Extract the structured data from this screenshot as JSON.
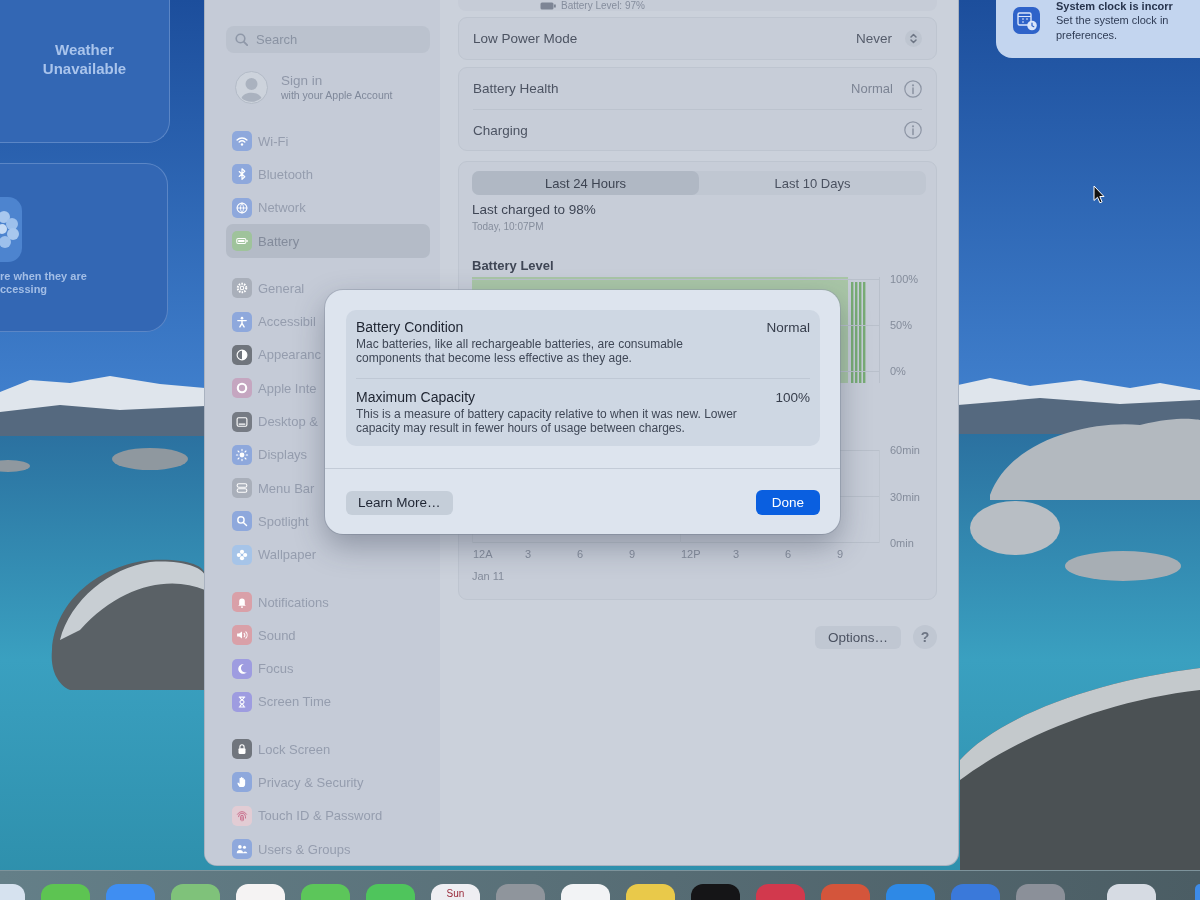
{
  "widgets": [
    {
      "kind": "weather",
      "text": "Weather Unavailable"
    },
    {
      "kind": "photos",
      "text": "re when they are ccessing"
    }
  ],
  "settings_window": {
    "sidebar": {
      "search": {
        "placeholder": "Search"
      },
      "account": {
        "title": "Sign in",
        "subtitle": "with your Apple Account"
      },
      "groups": [
        {
          "items": [
            {
              "label": "Wi-Fi",
              "kind": "wifi",
              "color": "#8ea8dc",
              "selected": false
            },
            {
              "label": "Bluetooth",
              "kind": "bluetooth",
              "color": "#8ea8dc",
              "selected": false
            },
            {
              "label": "Network",
              "kind": "network",
              "color": "#8ea8dc",
              "selected": false
            },
            {
              "label": "Battery",
              "kind": "battery",
              "color": "#9fc39b",
              "selected": true
            }
          ]
        },
        {
          "items": [
            {
              "label": "General",
              "kind": "general",
              "color": "#a9afba",
              "selected": false
            },
            {
              "label": "Accessibil",
              "kind": "accessibility",
              "color": "#8ea8dc",
              "selected": false
            },
            {
              "label": "Appearanc",
              "kind": "appearance",
              "color": "#70757d",
              "selected": false
            },
            {
              "label": "Apple Inte",
              "kind": "apple_intelligence",
              "color": "#c5a6c0",
              "selected": false
            },
            {
              "label": "Desktop &",
              "kind": "desktop",
              "color": "#767b84",
              "selected": false
            },
            {
              "label": "Displays",
              "kind": "displays",
              "color": "#8ea8dc",
              "selected": false
            },
            {
              "label": "Menu Bar",
              "kind": "menu_bar",
              "color": "#a9afba",
              "selected": false
            },
            {
              "label": "Spotlight",
              "kind": "spotlight",
              "color": "#8ea8dc",
              "selected": false
            },
            {
              "label": "Wallpaper",
              "kind": "wallpaper",
              "color": "#a6c4e8",
              "selected": false
            }
          ]
        },
        {
          "items": [
            {
              "label": "Notifications",
              "kind": "notifications",
              "color": "#d9a0a8",
              "selected": false
            },
            {
              "label": "Sound",
              "kind": "sound",
              "color": "#d9a0a8",
              "selected": false
            },
            {
              "label": "Focus",
              "kind": "focus",
              "color": "#9e9ce0",
              "selected": false
            },
            {
              "label": "Screen Time",
              "kind": "screen_time",
              "color": "#9e9ce0",
              "selected": false
            }
          ]
        },
        {
          "items": [
            {
              "label": "Lock Screen",
              "kind": "lock_screen",
              "color": "#70757d",
              "selected": false
            },
            {
              "label": "Privacy & Security",
              "kind": "privacy",
              "color": "#8ea8dc",
              "selected": false
            },
            {
              "label": "Touch ID & Password",
              "kind": "touch_id",
              "color": "#e2ccd4",
              "selected": false
            },
            {
              "label": "Users & Groups",
              "kind": "users",
              "color": "#8ea8dc",
              "selected": false
            }
          ]
        }
      ]
    },
    "content": {
      "status": "Battery Level: 97%",
      "low_power_mode": {
        "label": "Low Power Mode",
        "value": "Never"
      },
      "health_rows": [
        {
          "label": "Battery Health",
          "value": "Normal"
        },
        {
          "label": "Charging"
        }
      ],
      "usage": {
        "ranges": [
          {
            "label": "Last 24 Hours",
            "selected": true
          },
          {
            "label": "Last 10 Days",
            "selected": false
          }
        ],
        "last_charged": "Last charged to 98%",
        "last_charged_time": "Today, 10:07PM",
        "battery_level": {
          "title": "Battery Level",
          "y_labels": [
            "100%",
            "50%",
            "0%"
          ]
        },
        "minutes_chart": {
          "y_labels": [
            "60min",
            "30min",
            "0min"
          ],
          "x_labels": [
            "12A",
            "3",
            "6",
            "9",
            "12P",
            "3",
            "6",
            "9"
          ],
          "date": "Jan 11"
        }
      },
      "buttons": [
        {
          "label": "Options…",
          "kind": "options"
        },
        {
          "label": "?",
          "kind": "help"
        }
      ]
    },
    "sheet": {
      "rows": [
        {
          "title": "Battery Condition",
          "value": "Normal",
          "description": "Mac batteries, like all rechargeable batteries, are consumable\ncomponents that become less effective as they age."
        },
        {
          "title": "Maximum Capacity",
          "value": "100%",
          "description": "This is a measure of battery capacity relative to when it was new. Lower\ncapacity may result in fewer hours of usage between charges."
        }
      ],
      "buttons": [
        {
          "label": "Learn More…",
          "kind": "secondary"
        },
        {
          "label": "Done",
          "kind": "primary"
        }
      ]
    }
  },
  "notification": {
    "title": "System clock is incorr",
    "body": "Set the system clock in preferences."
  },
  "dock": {
    "apps": [
      {
        "kind": "tile",
        "color": "#d6e2ef"
      },
      {
        "kind": "tile",
        "color": "#5dc452"
      },
      {
        "kind": "tile",
        "color": "#3f8ef2"
      },
      {
        "kind": "tile",
        "color": "#7fc27a"
      },
      {
        "kind": "tile",
        "color": "#f5f3f3"
      },
      {
        "kind": "tile",
        "color": "#5cc65a"
      },
      {
        "kind": "tile",
        "color": "#4fc55c"
      },
      {
        "kind": "calendar",
        "color": "#eeeef2",
        "label": "Sun"
      },
      {
        "kind": "tile",
        "color": "#8f959c"
      },
      {
        "kind": "tile",
        "color": "#f2f3f5"
      },
      {
        "kind": "tile",
        "color": "#e9c94a"
      },
      {
        "kind": "tile",
        "color": "#151517"
      },
      {
        "kind": "tile",
        "color": "#d2394d"
      },
      {
        "kind": "tile",
        "color": "#d4553b"
      },
      {
        "kind": "tile",
        "color": "#2e89e6"
      },
      {
        "kind": "tile",
        "color": "#3a79da"
      },
      {
        "kind": "tile",
        "color": "#8b9099"
      },
      {
        "kind": "tile",
        "color": "#d6dbe3"
      },
      {
        "kind": "tile",
        "color": "#3d8be8"
      }
    ]
  }
}
